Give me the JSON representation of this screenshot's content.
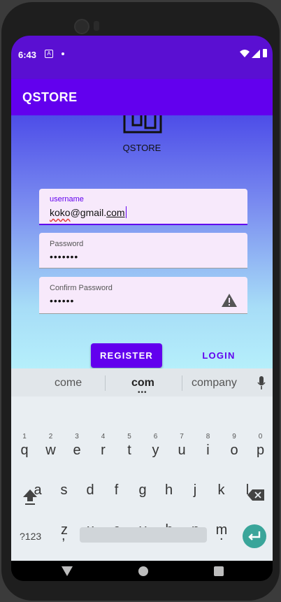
{
  "statusbar": {
    "time": "6:43",
    "a_icon": "A"
  },
  "appbar": {
    "title": "QSTORE"
  },
  "logo": {
    "label": "QSTORE"
  },
  "form": {
    "username_label": "username",
    "username_value_part1": "koko",
    "username_value_part2": "@gmail.",
    "username_value_part3": "com",
    "password_label": "Password",
    "password_value": "•••••••",
    "confirm_label": "Confirm Password",
    "confirm_value": "••••••"
  },
  "buttons": {
    "register": "REGISTER",
    "login": "LOGIN"
  },
  "keyboard": {
    "suggestions": [
      "come",
      "com",
      "company"
    ],
    "row1": [
      "q",
      "w",
      "e",
      "r",
      "t",
      "y",
      "u",
      "i",
      "o",
      "p"
    ],
    "row1_nums": [
      "1",
      "2",
      "3",
      "4",
      "5",
      "6",
      "7",
      "8",
      "9",
      "0"
    ],
    "row2": [
      "a",
      "s",
      "d",
      "f",
      "g",
      "h",
      "j",
      "k",
      "l"
    ],
    "row3": [
      "z",
      "x",
      "c",
      "v",
      "b",
      "n",
      "m"
    ],
    "symbols": "?123",
    "comma": ",",
    "period": "."
  },
  "colors": {
    "primary": "#6200ee",
    "status": "#5a0fd2",
    "accent_key": "#3aa59a"
  }
}
